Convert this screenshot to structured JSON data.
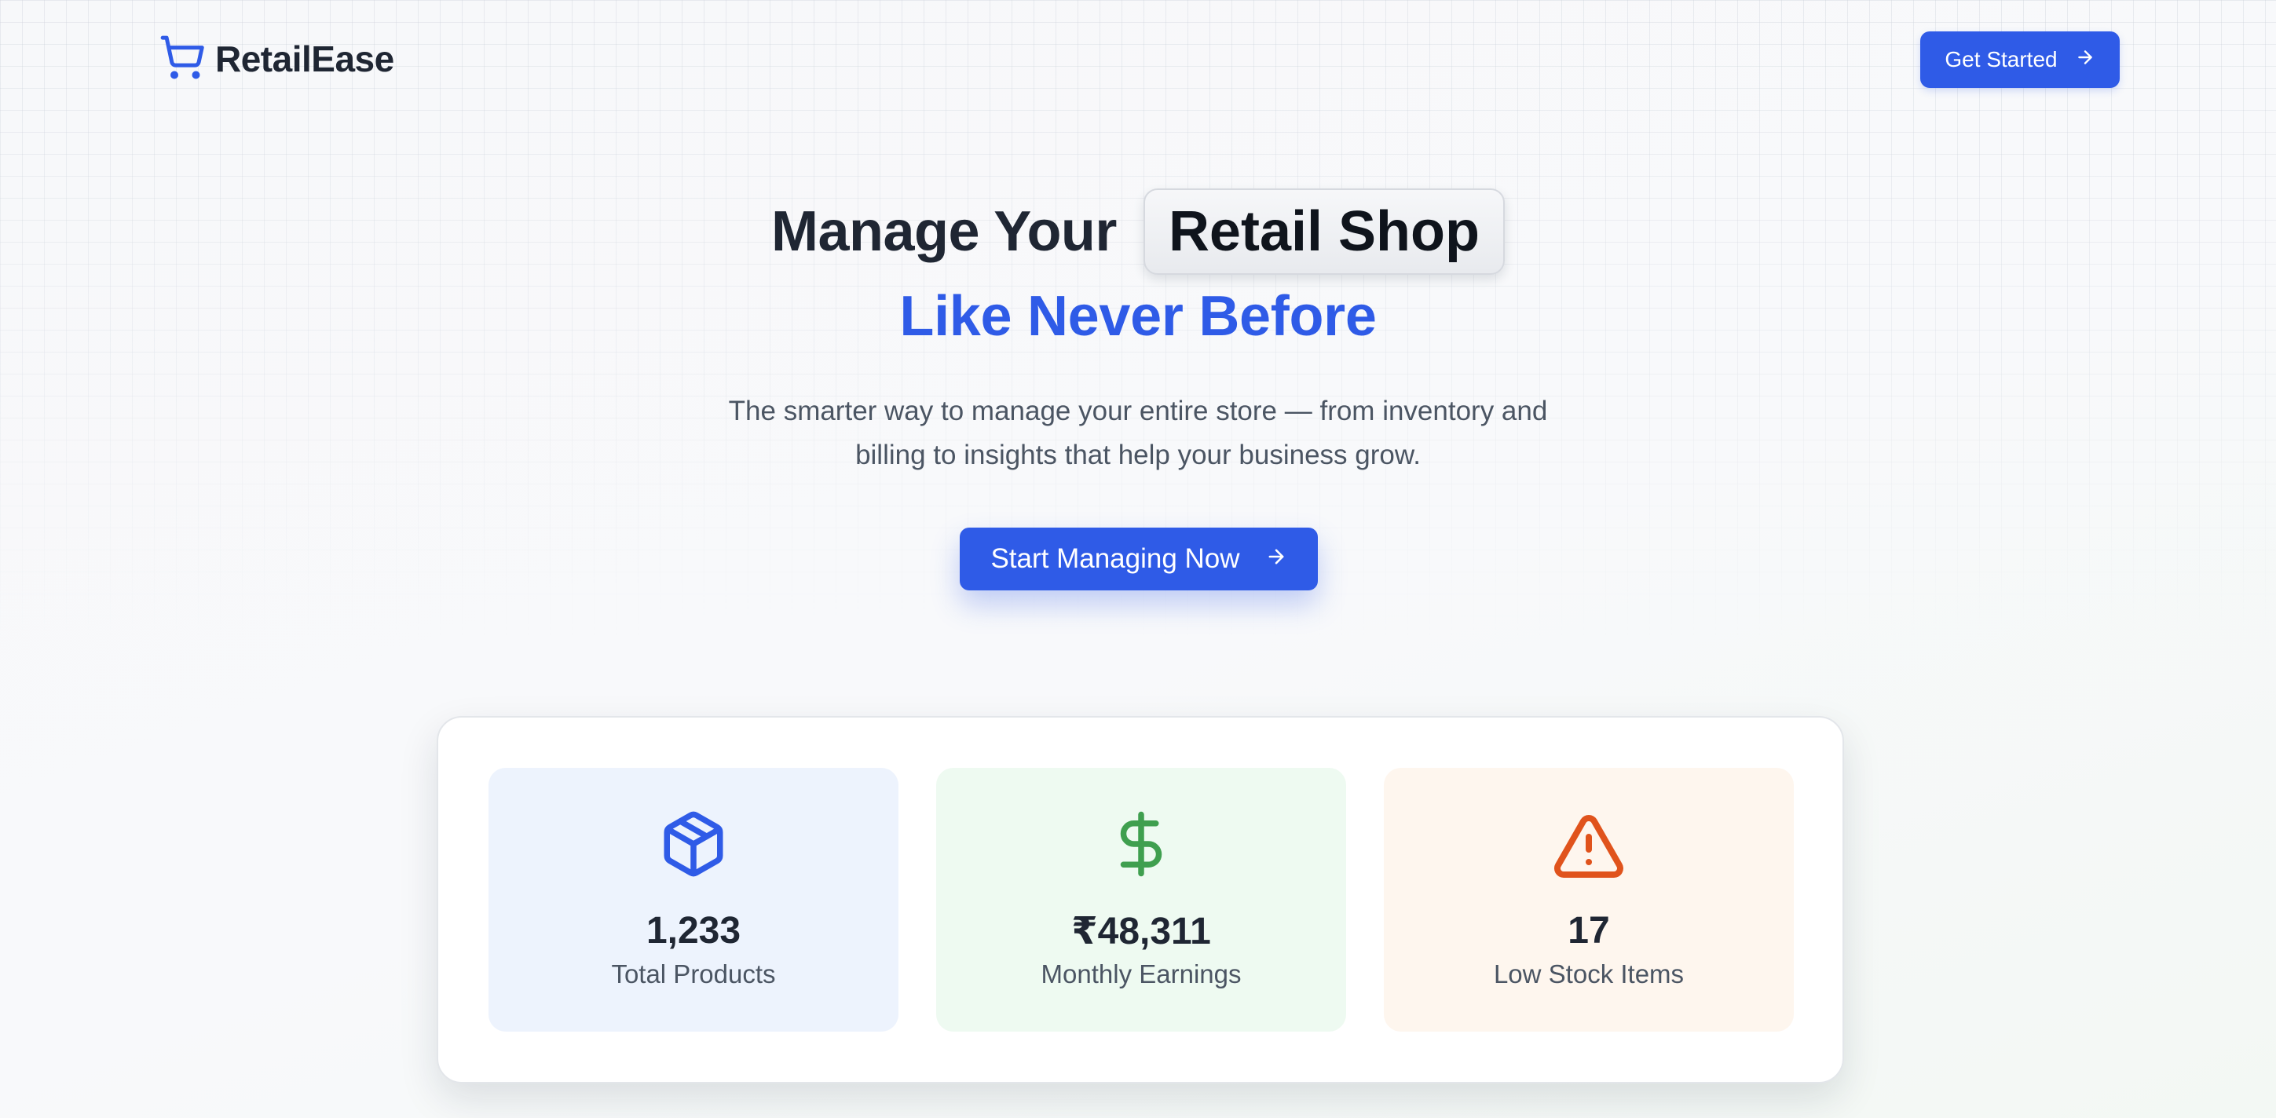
{
  "brand": {
    "name": "RetailEase",
    "icon": "shopping-cart-icon"
  },
  "nav": {
    "cta_label": "Get Started",
    "cta_icon": "arrow-right-icon"
  },
  "hero": {
    "title_lead": "Manage Your",
    "title_highlight": "Retail Shop",
    "title_accent": "Like Never Before",
    "subtitle_line1": "The smarter way to manage your entire store — from inventory and",
    "subtitle_line2": "billing to insights that help your business grow.",
    "cta_label": "Start Managing Now",
    "cta_icon": "arrow-right-icon"
  },
  "stats": [
    {
      "icon": "package-box-icon",
      "value": "1,233",
      "label": "Total Products",
      "accent": "#2f5be7",
      "bg": "#edf3fd"
    },
    {
      "icon": "dollar-sign-icon",
      "value": "₹48,311",
      "label": "Monthly Earnings",
      "accent": "#3f9f4f",
      "bg": "#eefaf1"
    },
    {
      "icon": "warning-triangle-icon",
      "value": "17",
      "label": "Low Stock Items",
      "accent": "#e0531c",
      "bg": "#fef6ee"
    }
  ],
  "colors": {
    "primary": "#2f5be7",
    "text": "#1f2633",
    "muted": "#4b5563"
  }
}
